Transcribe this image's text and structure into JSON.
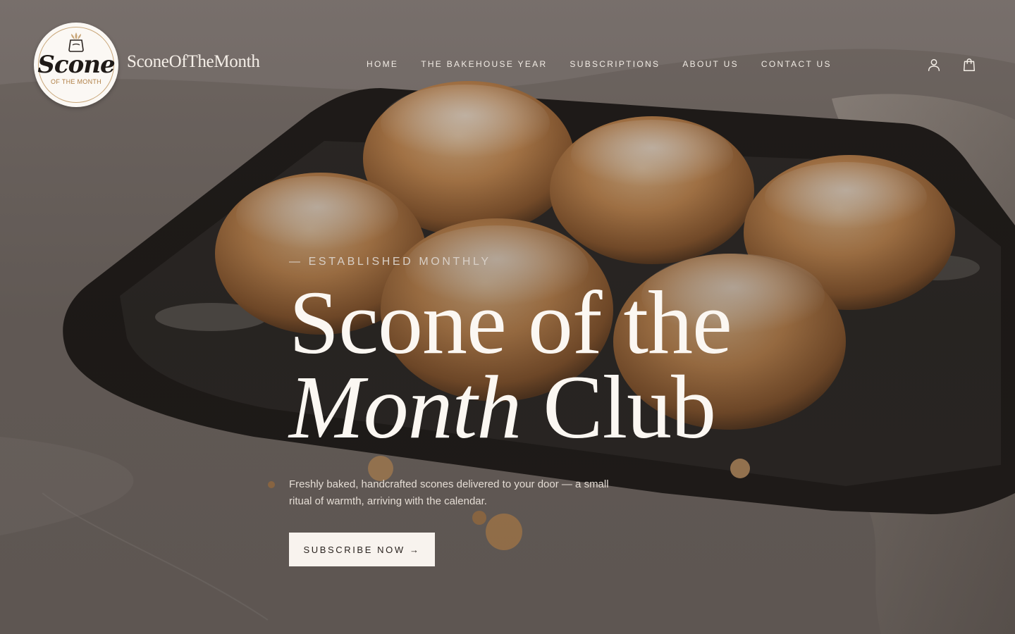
{
  "brand": {
    "logo_script": "Scone",
    "logo_subtitle": "OF THE MONTH",
    "name": "SconeOfTheMonth"
  },
  "nav": {
    "items": [
      {
        "label": "HOME"
      },
      {
        "label": "THE BAKEHOUSE YEAR"
      },
      {
        "label": "SUBSCRIPTIONS"
      },
      {
        "label": "ABOUT US"
      },
      {
        "label": "CONTACT US"
      }
    ]
  },
  "header_icons": {
    "account": "user-icon",
    "cart": "shopping-bag-icon"
  },
  "hero": {
    "eyebrow": "— ESTABLISHED MONTHLY",
    "headline_line1": "Scone of the",
    "headline_italic": "Month",
    "headline_rest": " Club",
    "description": "Freshly baked, handcrafted scones delivered to your door — a small ritual of warmth, arriving with the calendar.",
    "cta_label": "SUBSCRIBE NOW →"
  },
  "colors": {
    "headline_text": "#fbf7f2",
    "cta_background": "#f8f3ee",
    "cta_text": "#2a231f",
    "logo_accent": "#b07f45"
  }
}
